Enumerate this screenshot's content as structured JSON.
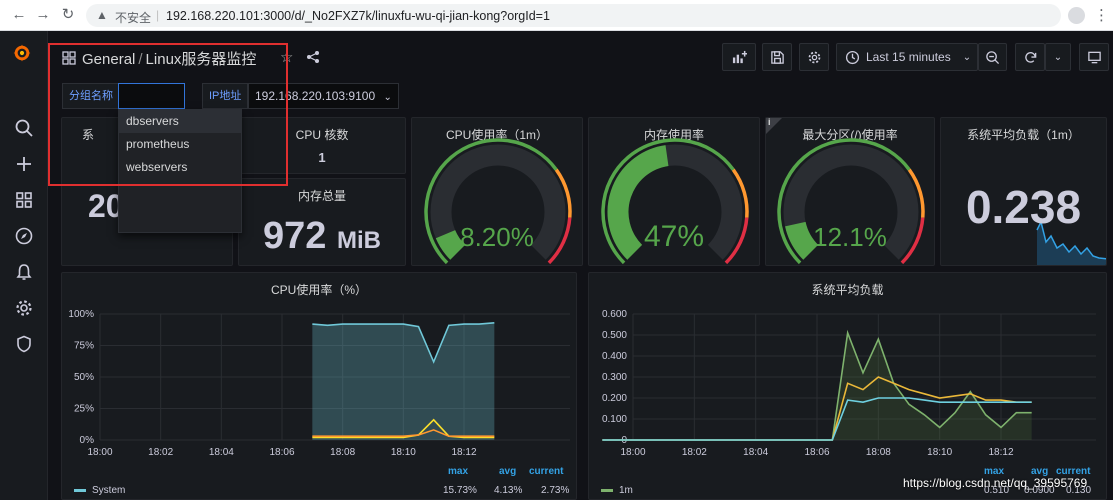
{
  "browser": {
    "security_label": "不安全",
    "url": "192.168.220.101:3000/d/_No2FXZ7k/linuxfu-wu-qi-jian-kong?orgId=1"
  },
  "dashboard": {
    "folder": "General",
    "separator": "/",
    "title": "Linux服务器监控",
    "time_range": "Last 15 minutes"
  },
  "variables": {
    "group_label": "分组名称",
    "group_value": "",
    "ip_label": "IP地址",
    "ip_value": "192.168.220.103:9100",
    "group_options": [
      "dbservers",
      "prometheus",
      "webservers"
    ]
  },
  "panels": {
    "uptime": {
      "title_fragment": "系",
      "value": "20"
    },
    "cpu_cores": {
      "title": "CPU 核数",
      "value": "1"
    },
    "mem_total": {
      "title": "内存总量",
      "value": "972",
      "unit": "MiB"
    },
    "cpu_usage": {
      "title": "CPU使用率（1m）",
      "value": "8.20%",
      "percent": 8.2
    },
    "mem_usage": {
      "title": "内存使用率",
      "value": "47%",
      "percent": 47
    },
    "disk_usage": {
      "title": "最大分区(/)使用率",
      "value": "12.1%",
      "percent": 12.1
    },
    "load": {
      "title": "系统平均负载（1m）",
      "value": "0.238"
    }
  },
  "colors": {
    "green": "#56a64b",
    "orange": "#ff9830",
    "red": "#e02f44",
    "yellow": "#fade2a",
    "blue": "#33a2e5",
    "cyan": "#70c8d8"
  },
  "chart_data": [
    {
      "type": "line",
      "title": "CPU使用率（%）",
      "x_ticks": [
        "18:00",
        "18:02",
        "18:04",
        "18:06",
        "18:08",
        "18:10",
        "18:12"
      ],
      "y_ticks": [
        "0%",
        "25%",
        "50%",
        "75%",
        "100%"
      ],
      "ylim": [
        0,
        100
      ],
      "x": [
        "18:07",
        "18:07:30",
        "18:08",
        "18:08:30",
        "18:09",
        "18:09:30",
        "18:10",
        "18:10:30",
        "18:11",
        "18:11:30",
        "18:12",
        "18:12:30",
        "18:13"
      ],
      "series": [
        {
          "name": "System",
          "color": "#70c8d8",
          "values": [
            92,
            91,
            92,
            92,
            92,
            92,
            92,
            90,
            62,
            91,
            92,
            92,
            93
          ]
        },
        {
          "color": "#fade2a",
          "values": [
            2,
            2,
            2,
            2,
            2,
            2,
            2,
            4,
            16,
            3,
            2,
            2,
            2
          ]
        },
        {
          "color": "#ff9830",
          "values": [
            3,
            3,
            3,
            3,
            3,
            3,
            3,
            4,
            8,
            3,
            3,
            3,
            3
          ]
        }
      ],
      "legend": {
        "headers": [
          "max",
          "avg",
          "current"
        ],
        "rows": [
          {
            "name": "System",
            "max": "15.73%",
            "avg": "4.13%",
            "current": "2.73%"
          }
        ]
      }
    },
    {
      "type": "line",
      "title": "系统平均负载",
      "x_ticks": [
        "18:00",
        "18:02",
        "18:04",
        "18:06",
        "18:08",
        "18:10",
        "18:12"
      ],
      "y_ticks": [
        "0",
        "0.100",
        "0.200",
        "0.300",
        "0.400",
        "0.500",
        "0.600"
      ],
      "ylim": [
        0,
        0.6
      ],
      "x": [
        "17:59",
        "18:06:30",
        "18:07",
        "18:07:30",
        "18:08",
        "18:08:30",
        "18:09",
        "18:09:30",
        "18:10",
        "18:10:30",
        "18:11",
        "18:11:30",
        "18:12",
        "18:12:30",
        "18:13"
      ],
      "series": [
        {
          "name": "1m",
          "color": "#7eb26d",
          "values": [
            0,
            0,
            0.51,
            0.32,
            0.48,
            0.27,
            0.17,
            0.12,
            0.06,
            0.13,
            0.23,
            0.12,
            0.06,
            0.13,
            0.13
          ]
        },
        {
          "color": "#eab839",
          "values": [
            0,
            0,
            0.27,
            0.24,
            0.3,
            0.27,
            0.24,
            0.22,
            0.2,
            0.21,
            0.22,
            0.19,
            0.19,
            0.18,
            0.18
          ]
        },
        {
          "color": "#6ed0e0",
          "values": [
            0,
            0,
            0.19,
            0.18,
            0.2,
            0.2,
            0.2,
            0.19,
            0.18,
            0.18,
            0.18,
            0.18,
            0.18,
            0.18,
            0.18
          ]
        }
      ],
      "legend": {
        "headers": [
          "max",
          "avg",
          "current"
        ],
        "rows": [
          {
            "name": "1m",
            "max": "0.510",
            "avg": "0.0900",
            "current": "0.130"
          }
        ]
      }
    }
  ],
  "watermark": "https://blog.csdn.net/qq_39595769"
}
